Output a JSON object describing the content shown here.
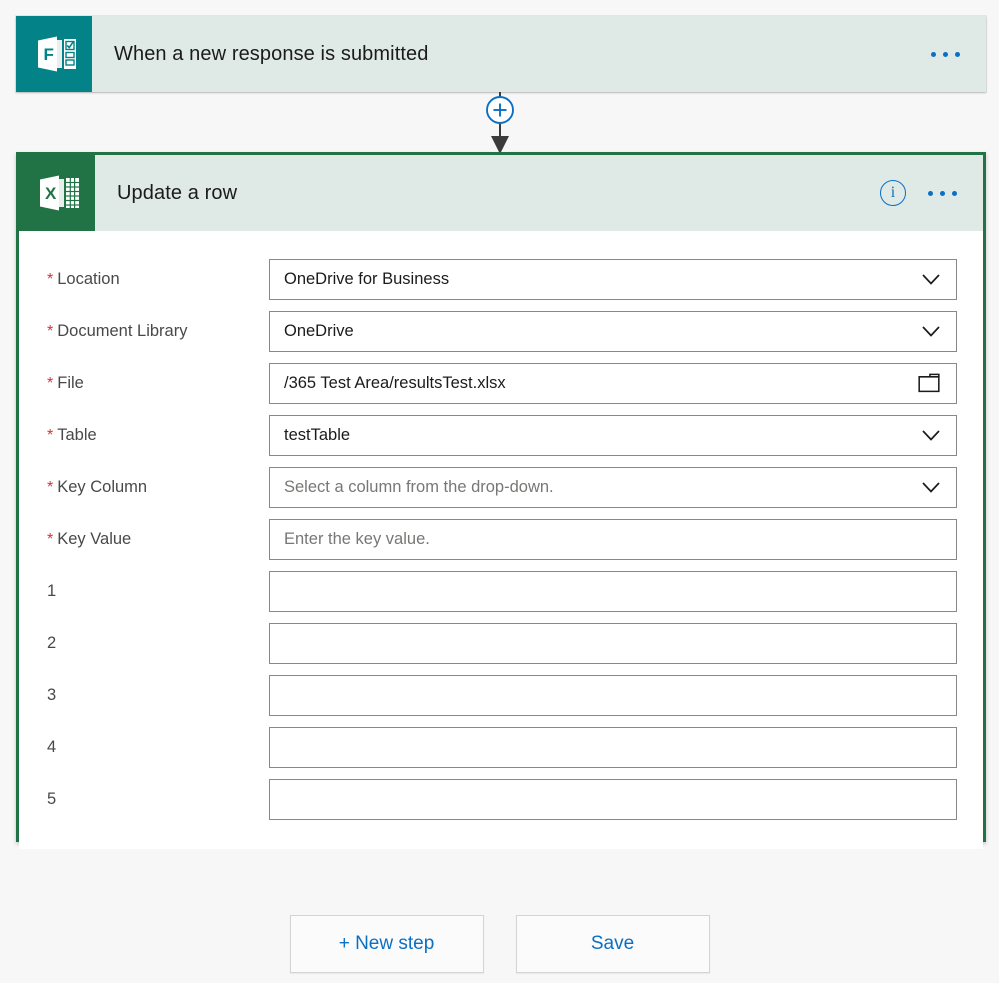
{
  "trigger": {
    "title": "When a new response is submitted",
    "icon": "microsoft-forms-icon",
    "menu_label": "•••"
  },
  "action": {
    "title": "Update a row",
    "icon": "microsoft-excel-icon",
    "info_label": "i",
    "menu_label": "•••",
    "fields": [
      {
        "label": "Location",
        "required": true,
        "type": "select",
        "value": "OneDrive for Business",
        "placeholder": ""
      },
      {
        "label": "Document Library",
        "required": true,
        "type": "select",
        "value": "OneDrive",
        "placeholder": ""
      },
      {
        "label": "File",
        "required": true,
        "type": "file",
        "value": "/365 Test Area/resultsTest.xlsx",
        "placeholder": ""
      },
      {
        "label": "Table",
        "required": true,
        "type": "select",
        "value": "testTable",
        "placeholder": ""
      },
      {
        "label": "Key Column",
        "required": true,
        "type": "select",
        "value": "",
        "placeholder": "Select a column from the drop-down."
      },
      {
        "label": "Key Value",
        "required": true,
        "type": "text",
        "value": "",
        "placeholder": "Enter the key value."
      },
      {
        "label": "1",
        "required": false,
        "type": "text",
        "value": "",
        "placeholder": ""
      },
      {
        "label": "2",
        "required": false,
        "type": "text",
        "value": "",
        "placeholder": ""
      },
      {
        "label": "3",
        "required": false,
        "type": "text",
        "value": "",
        "placeholder": ""
      },
      {
        "label": "4",
        "required": false,
        "type": "text",
        "value": "",
        "placeholder": ""
      },
      {
        "label": "5",
        "required": false,
        "type": "text",
        "value": "",
        "placeholder": ""
      }
    ]
  },
  "connector": {
    "add_label": "+"
  },
  "footer": {
    "new_step_label": "+ New step",
    "save_label": "Save"
  },
  "colors": {
    "forms_brand": "#038387",
    "excel_brand": "#217346",
    "header_bg": "#dfe9e6",
    "accent_blue": "#0b70c4",
    "required_red": "#d13438",
    "page_bg": "#f7f7f7"
  }
}
